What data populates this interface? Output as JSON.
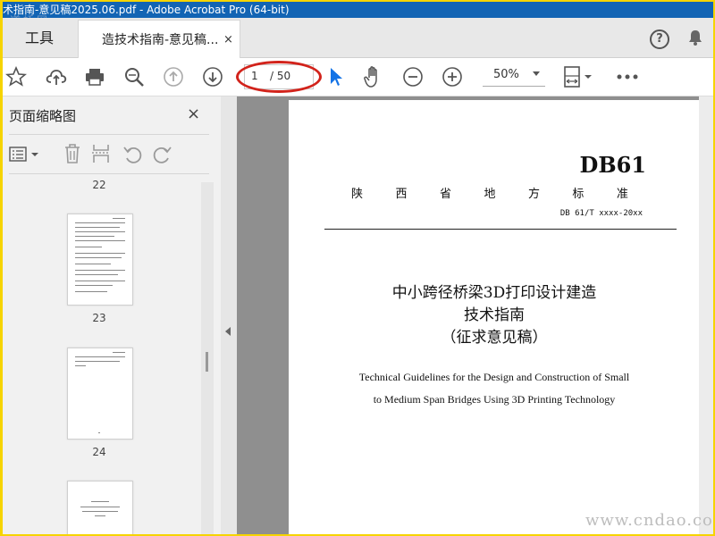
{
  "window": {
    "title": "术指南-意见稿2025.06.pdf - Adobe Acrobat Pro (64-bit)",
    "watermark_top": "道桥网"
  },
  "tabs": {
    "tools": "工具",
    "document": "造技术指南-意见稿...",
    "close": "×"
  },
  "toolbar": {
    "page_current": "1",
    "page_total": "/ 50",
    "zoom": "50%",
    "icons": [
      "bookmark-star-icon",
      "upload-cloud-icon",
      "print-icon",
      "zoom-search-icon",
      "prev-page-icon",
      "next-page-icon",
      "select-cursor-icon",
      "hand-icon",
      "zoom-out-icon",
      "zoom-in-icon",
      "fit-page-icon",
      "more-icon"
    ],
    "accent": "#1473e6",
    "highlight": "#d2231b"
  },
  "sidebar": {
    "title": "页面缩略图",
    "close": "×",
    "thumbnails": [
      {
        "label": "22"
      },
      {
        "label": "23"
      },
      {
        "label": "24"
      },
      {
        "label": ""
      }
    ]
  },
  "document": {
    "code": "DB61",
    "province_standard": [
      "陕",
      "西",
      "省",
      "地",
      "方",
      "标",
      "准"
    ],
    "std_number": "DB 61/T xxxx-20xx",
    "zh_title_line1": "中小跨径桥梁3D打印设计建造",
    "zh_title_line2": "技术指南",
    "zh_title_line3": "（征求意见稿）",
    "en_title_line1": "Technical Guidelines for the Design and Construction of Small",
    "en_title_line2": "to Medium Span Bridges Using 3D Printing Technology"
  },
  "site_watermark": "www.cndao.com"
}
